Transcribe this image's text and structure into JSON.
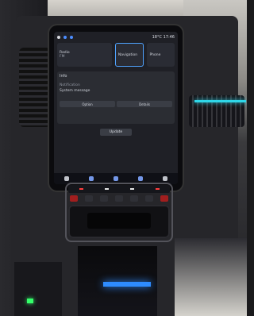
{
  "screen": {
    "status_time": "17:46",
    "status_temp": "18°C",
    "cards": {
      "left_title": "Radio",
      "left_sub": "FM",
      "mid_title": "Navigation",
      "right_title": "Phone"
    },
    "panel": {
      "title": "Info",
      "sub": "Notification",
      "text": "System message",
      "buttons": [
        "Option",
        "Details"
      ]
    },
    "center_button": "Update"
  },
  "colors": {
    "accent": "#4fa3ff",
    "ambient": "#2fd6e8",
    "led_red": "#ff3e3e",
    "led_green": "#34ff6a"
  }
}
